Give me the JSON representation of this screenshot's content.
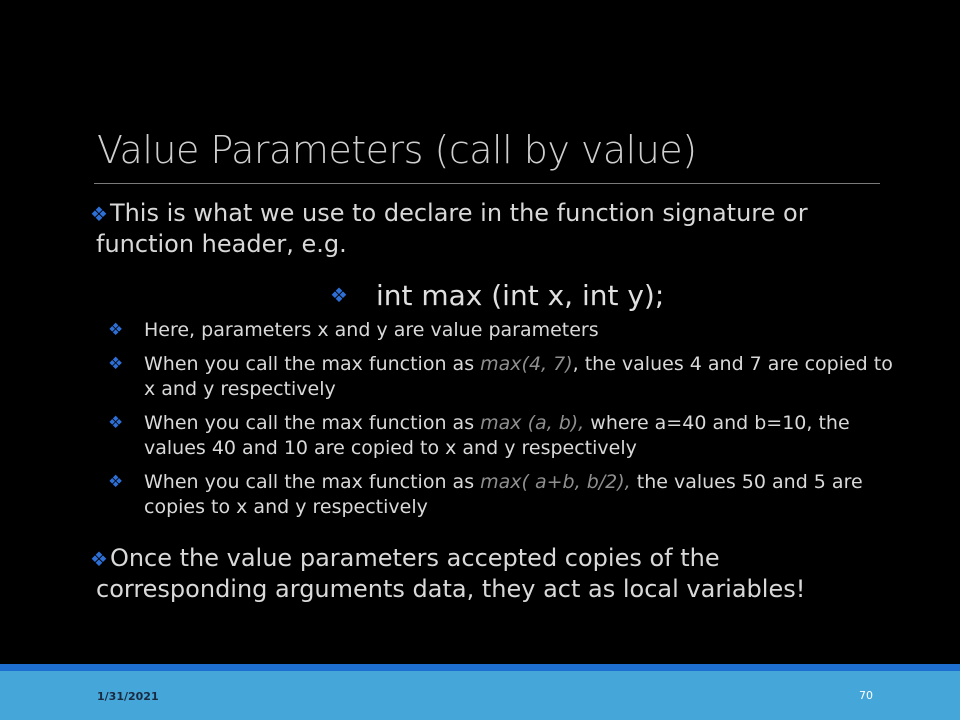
{
  "slide": {
    "title": "Value Parameters (call by value)",
    "bullet1": "This is what we use to declare in the function signature or",
    "bullet1_cont": "function header, e.g.",
    "code": "int max (int x, int y);",
    "sub1": "Here, parameters x and y are value parameters",
    "sub2_pre": "When you call the max function as ",
    "sub2_code": "max(4, 7)",
    "sub2_post": ", the values 4 and 7 are copied to x and y respectively",
    "sub3_pre": "When you call the max function as ",
    "sub3_code": "max (a, b),",
    "sub3_post": " where a=40 and b=10, the values 40 and 10 are copied to x and y respectively",
    "sub4_pre": "When you call the max function as ",
    "sub4_code": "max( a+b, b/2),",
    "sub4_post": " the values 50 and 5 are copies to x and y respectively",
    "bullet2": "Once the value parameters accepted copies of the",
    "bullet2_cont": "corresponding arguments data, they act as local variables!"
  },
  "footer": {
    "date": "1/31/2021",
    "page": "70"
  },
  "icons": {
    "bullet": "diamond-bullet-icon"
  },
  "colors": {
    "background": "#000000",
    "bullet": "#2e6fd6",
    "footer_bar": "#45a7d9",
    "footer_line": "#1e6fcf"
  }
}
